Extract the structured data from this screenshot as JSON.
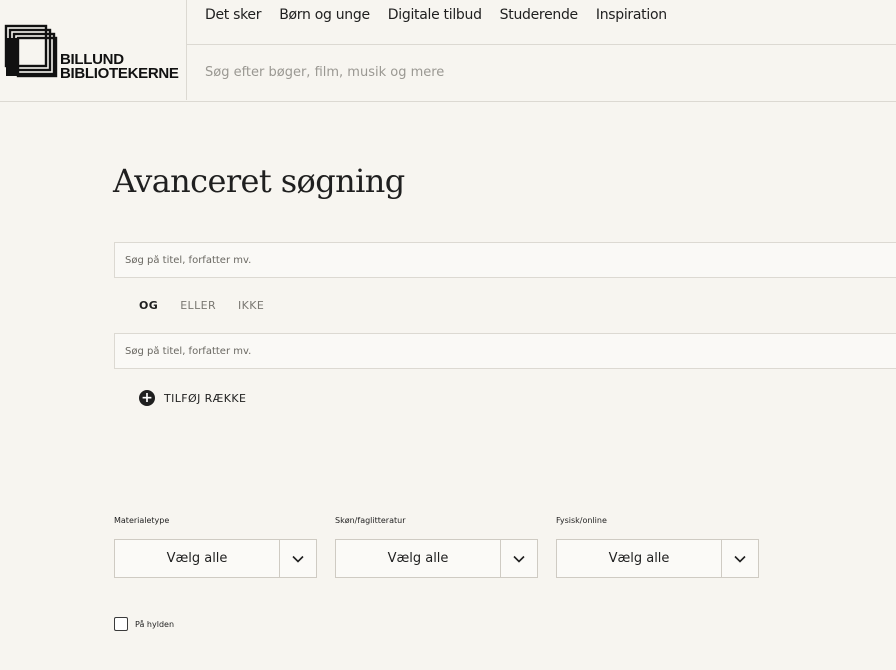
{
  "header": {
    "logo": {
      "line1": "BILLUND",
      "line2": "BIBLIOTEKERNE",
      "icon": "library-logo-icon"
    },
    "nav": [
      {
        "label": "Det sker"
      },
      {
        "label": "Børn og unge"
      },
      {
        "label": "Digitale tilbud"
      },
      {
        "label": "Studerende"
      },
      {
        "label": "Inspiration"
      }
    ],
    "search": {
      "placeholder": "Søg efter bøger, film, musik og mere",
      "value": ""
    }
  },
  "main": {
    "title": "Avanceret søgning",
    "rows": [
      {
        "placeholder": "Søg på titel, forfatter mv.",
        "value": ""
      },
      {
        "placeholder": "Søg på titel, forfatter mv.",
        "value": ""
      }
    ],
    "operators": [
      {
        "label": "OG",
        "active": true
      },
      {
        "label": "ELLER",
        "active": false
      },
      {
        "label": "IKKE",
        "active": false
      }
    ],
    "add_row": {
      "label": "TILFØJ RÆKKE",
      "icon": "plus-circle-icon"
    }
  },
  "filters": [
    {
      "label": "Materialetype",
      "value": "Vælg alle",
      "icon": "chevron-down-icon"
    },
    {
      "label": "Skøn/faglitteratur",
      "value": "Vælg alle",
      "icon": "chevron-down-icon"
    },
    {
      "label": "Fysisk/online",
      "value": "Vælg alle",
      "icon": "chevron-down-icon"
    }
  ],
  "on_shelf": {
    "label": "På hylden",
    "checked": false
  },
  "colors": {
    "background": "#f7f5f0",
    "text": "#1f1f1f",
    "border": "#dcd9d2"
  }
}
